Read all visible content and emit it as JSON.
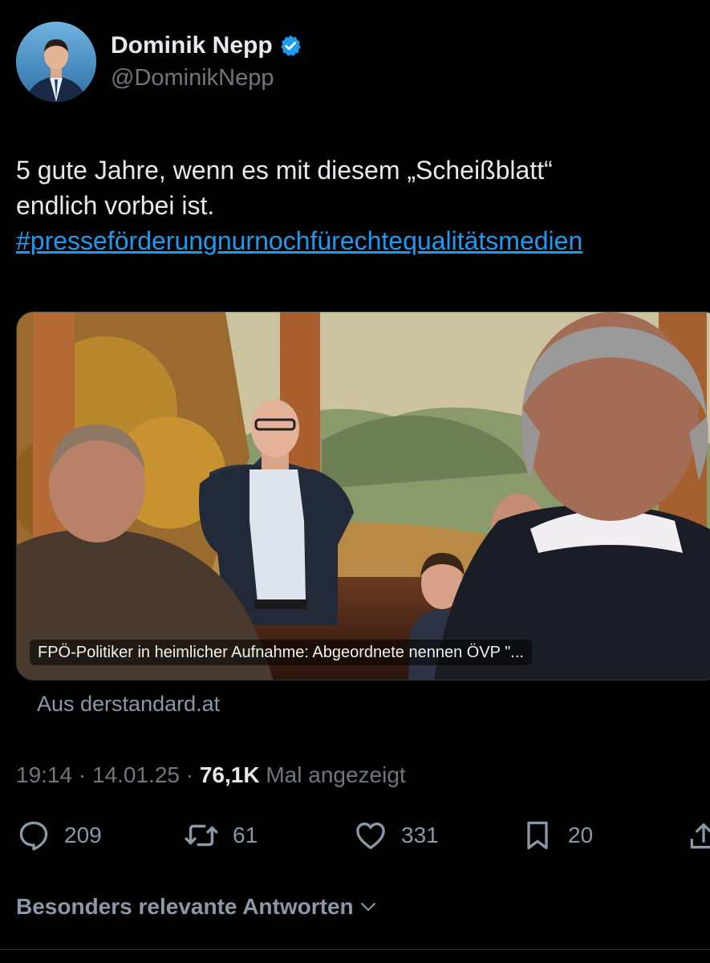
{
  "author": {
    "display_name": "Dominik Nepp",
    "handle": "@DominikNepp",
    "verified_color": "#1d9bf0"
  },
  "tweet": {
    "text_line1": "5 gute Jahre, wenn es mit diesem „Scheißblatt“",
    "text_line2": "endlich vorbei ist.",
    "hashtag": "#presseförderungnurnochfürechtequalitätsmedien"
  },
  "card": {
    "caption": "FPÖ-Politiker in heimlicher Aufnahme: Abgeordnete nennen ÖVP \"...",
    "source": "Aus derstandard.at"
  },
  "meta": {
    "time": "19:14",
    "sep1": " · ",
    "date": "14.01.25",
    "sep2": " · ",
    "views": "76,1K",
    "views_label": " Mal angezeigt"
  },
  "actions": {
    "replies": "209",
    "reposts": "61",
    "likes": "331",
    "bookmarks": "20"
  },
  "sort": {
    "label": "Besonders relevante Antworten"
  },
  "colors": {
    "background": "#000000",
    "text": "#e7e9ea",
    "secondary": "#71767b",
    "link": "#1d9bf0"
  }
}
